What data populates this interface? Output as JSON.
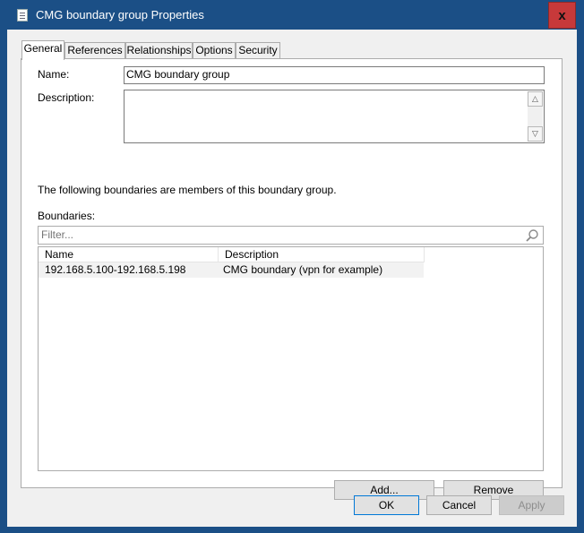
{
  "window": {
    "title": "CMG boundary group Properties",
    "close_label": "x",
    "accent": "#1b4f86",
    "close_color": "#c7393a"
  },
  "tabs": [
    {
      "label": "General",
      "active": true
    },
    {
      "label": "References",
      "active": false
    },
    {
      "label": "Relationships",
      "active": false
    },
    {
      "label": "Options",
      "active": false
    },
    {
      "label": "Security",
      "active": false
    }
  ],
  "general": {
    "name_label": "Name:",
    "name_value": "CMG boundary group",
    "description_label": "Description:",
    "description_value": "",
    "members_text": "The following boundaries are members of this boundary group.",
    "boundaries_label": "Boundaries:",
    "filter_placeholder": "Filter...",
    "columns": [
      "Name",
      "Description"
    ],
    "rows": [
      {
        "name": "192.168.5.100-192.168.5.198",
        "description": "CMG boundary (vpn for example)"
      }
    ],
    "add_label": "Add...",
    "remove_label": "Remove"
  },
  "footer": {
    "ok_label": "OK",
    "cancel_label": "Cancel",
    "apply_label": "Apply"
  }
}
